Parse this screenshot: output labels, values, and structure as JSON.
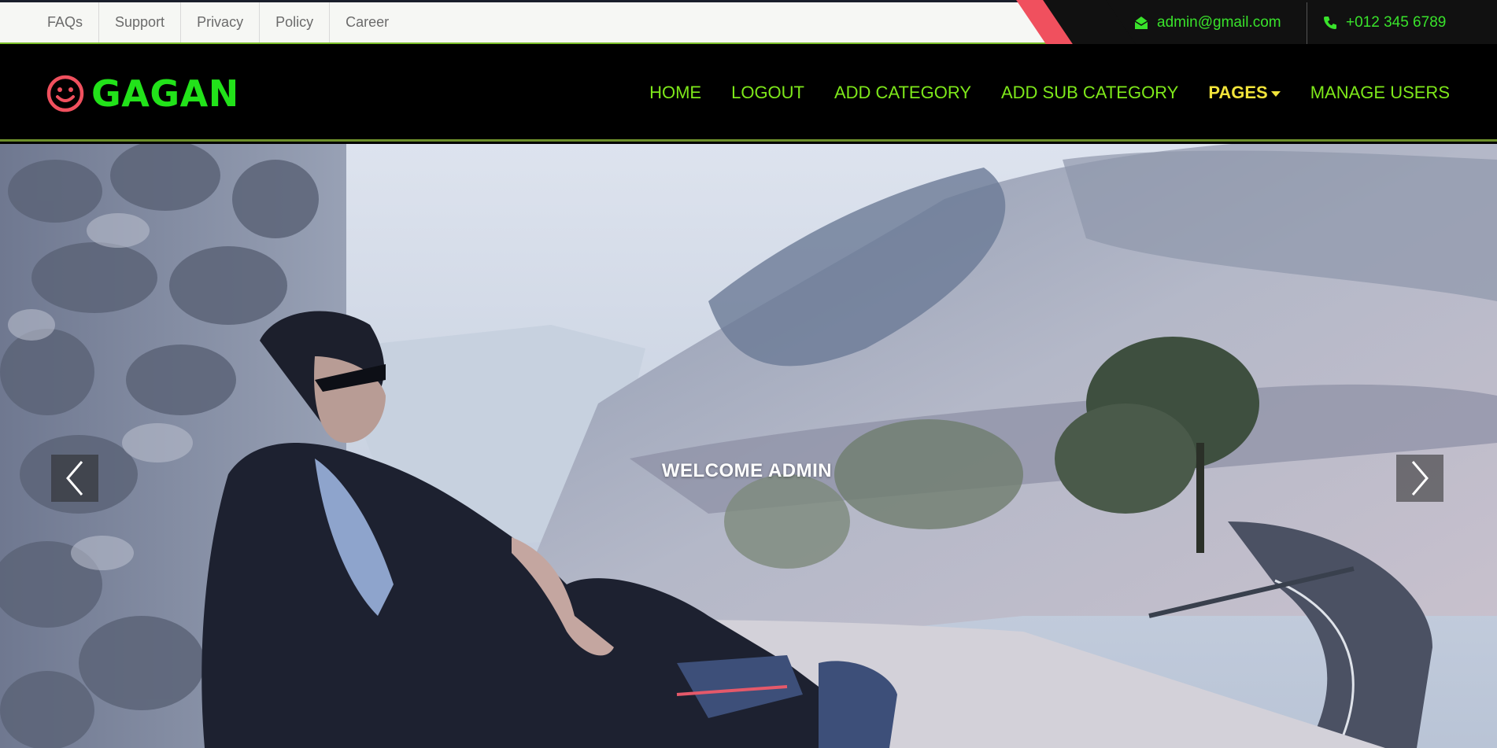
{
  "topbar": {
    "links": [
      "FAQs",
      "Support",
      "Privacy",
      "Policy",
      "Career"
    ],
    "email": "admin@gmail.com",
    "phone": "+012 345 6789"
  },
  "navbar": {
    "brand": "GAGAN",
    "items": [
      "HOME",
      "LOGOUT",
      "ADD CATEGORY",
      "ADD SUB CATEGORY",
      "PAGES",
      "MANAGE USERS"
    ],
    "active_item": "PAGES"
  },
  "hero": {
    "caption": "WELCOME ADMIN"
  },
  "colors": {
    "brand_green": "#22e21a",
    "nav_green": "#7ee81a",
    "active_yellow": "#f1e33a",
    "accent_red": "#f0505e"
  },
  "icons": [
    "envelope-icon",
    "phone-icon",
    "smiley-icon",
    "chevron-left-icon",
    "chevron-right-icon"
  ]
}
